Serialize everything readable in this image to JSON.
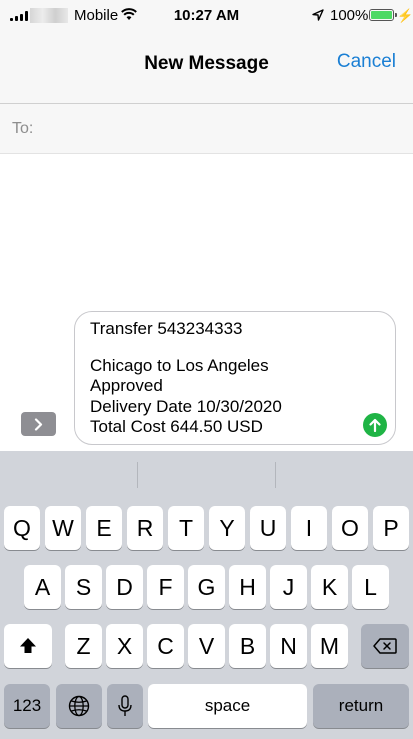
{
  "status_bar": {
    "carrier": "Mobile",
    "time": "10:27 AM",
    "battery": "100%",
    "icons": [
      "signal-icon",
      "wifi-icon",
      "location-icon",
      "battery-icon",
      "charging-icon"
    ]
  },
  "nav": {
    "title": "New Message",
    "cancel_label": "Cancel"
  },
  "recipient": {
    "to_label": "To:",
    "value": ""
  },
  "compose": {
    "lines": [
      "Transfer 543234333",
      "",
      "Chicago to Los Angeles",
      "Approved",
      "Delivery Date 10/30/2020",
      "Total Cost 644.50 USD"
    ]
  },
  "keyboard": {
    "row1": [
      "Q",
      "W",
      "E",
      "R",
      "T",
      "Y",
      "U",
      "I",
      "O",
      "P"
    ],
    "row2": [
      "A",
      "S",
      "D",
      "F",
      "G",
      "H",
      "J",
      "K",
      "L"
    ],
    "row3": [
      "Z",
      "X",
      "C",
      "V",
      "B",
      "N",
      "M"
    ],
    "numbers_label": "123",
    "space_label": "space",
    "return_label": "return"
  },
  "colors": {
    "accent": "#1a7fd4",
    "send": "#1fb445",
    "battery": "#4cd964",
    "keyboard_bg": "#d1d4da"
  }
}
